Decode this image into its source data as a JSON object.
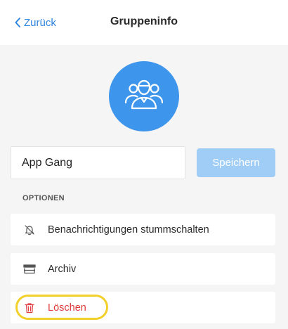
{
  "header": {
    "back_label": "Zurück",
    "title": "Gruppeninfo"
  },
  "group": {
    "avatar_icon": "group-users-icon",
    "avatar_color": "#3d95ec",
    "name_value": "App Gang"
  },
  "actions": {
    "save_label": "Speichern"
  },
  "options": {
    "section_label": "OPTIONEN",
    "items": [
      {
        "label": "Benachrichtigungen stummschalten",
        "icon": "bell-off-icon"
      },
      {
        "label": "Archiv",
        "icon": "archive-icon"
      },
      {
        "label": "Löschen",
        "icon": "trash-icon",
        "color": "#e03b3b"
      }
    ]
  },
  "colors": {
    "accent": "#2f86e0",
    "danger": "#e03b3b",
    "highlight": "#f2d02b"
  }
}
